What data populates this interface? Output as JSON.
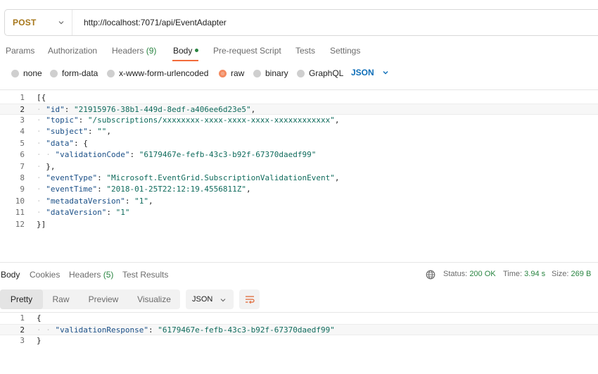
{
  "request": {
    "method": "POST",
    "url": "http://localhost:7071/api/EventAdapter"
  },
  "request_tabs": [
    {
      "label": "Params"
    },
    {
      "label": "Authorization"
    },
    {
      "label": "Headers",
      "count": "(9)"
    },
    {
      "label": "Body",
      "active": true,
      "indicator": "green-dot"
    },
    {
      "label": "Pre-request Script"
    },
    {
      "label": "Tests"
    },
    {
      "label": "Settings"
    }
  ],
  "body_types": {
    "options": [
      "none",
      "form-data",
      "x-www-form-urlencoded",
      "raw",
      "binary",
      "GraphQL"
    ],
    "selected": "raw",
    "format": "JSON"
  },
  "request_body_lines": [
    {
      "num": "1",
      "text": "[{"
    },
    {
      "num": "2",
      "text": "  \"id\": \"21915976-38b1-449d-8edf-a406ee6d23e5\","
    },
    {
      "num": "3",
      "text": "  \"topic\": \"/subscriptions/xxxxxxxx-xxxx-xxxx-xxxx-xxxxxxxxxxxx\","
    },
    {
      "num": "4",
      "text": "  \"subject\": \"\","
    },
    {
      "num": "5",
      "text": "  \"data\": {"
    },
    {
      "num": "6",
      "text": "    \"validationCode\": \"6179467e-fefb-43c3-b92f-67370daedf99\""
    },
    {
      "num": "7",
      "text": "  },"
    },
    {
      "num": "8",
      "text": "  \"eventType\": \"Microsoft.EventGrid.SubscriptionValidationEvent\","
    },
    {
      "num": "9",
      "text": "  \"eventTime\": \"2018-01-25T22:12:19.4556811Z\","
    },
    {
      "num": "10",
      "text": "  \"metadataVersion\": \"1\","
    },
    {
      "num": "11",
      "text": "  \"dataVersion\": \"1\""
    },
    {
      "num": "12",
      "text": "}]"
    }
  ],
  "response_tabs": [
    {
      "label": "Body",
      "active": true
    },
    {
      "label": "Cookies"
    },
    {
      "label": "Headers",
      "count": "(5)"
    },
    {
      "label": "Test Results"
    }
  ],
  "response_status": {
    "status_label": "Status:",
    "status_value": "200 OK",
    "time_label": "Time:",
    "time_value": "3.94 s",
    "size_label": "Size:",
    "size_value": "269 B"
  },
  "response_views": [
    "Pretty",
    "Raw",
    "Preview",
    "Visualize"
  ],
  "response_format": "JSON",
  "response_body_lines": [
    {
      "num": "1",
      "text": "{"
    },
    {
      "num": "2",
      "text": "    \"validationResponse\": \"6179467e-fefb-43c3-b92f-67370daedf99\""
    },
    {
      "num": "3",
      "text": "}"
    }
  ],
  "colors": {
    "method": "#a6771b",
    "accent": "#f26b3a",
    "success": "#2a8542",
    "link": "#0d6eb8"
  },
  "icons": [
    "chevron-down-icon",
    "globe-icon",
    "wrap-lines-icon"
  ]
}
